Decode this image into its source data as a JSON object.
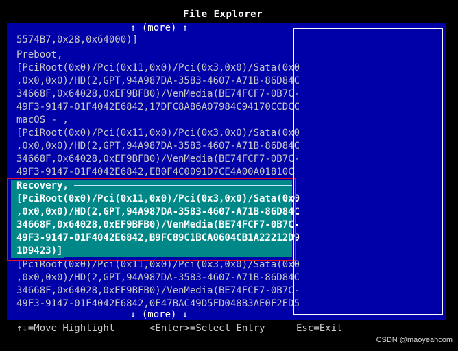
{
  "window": {
    "title": "File Explorer"
  },
  "scroll": {
    "more_up": "↑ (more) ↑",
    "more_down": "↓ (more) ↓"
  },
  "lines": [
    "5574B7,0x28,0x64000)]",
    "Preboot,",
    "[PciRoot(0x0)/Pci(0x11,0x0)/Pci(0x3,0x0)/Sata(0x0",
    ",0x0,0x0)/HD(2,GPT,94A987DA-3583-4607-A71B-86D84C",
    "34668F,0x64028,0xEF9BFB0)/VenMedia(BE74FCF7-0B7C-",
    "49F3-9147-01F4042E6842,17DFC8A86A07984C94170CCDCC",
    "macOS - ,",
    "[PciRoot(0x0)/Pci(0x11,0x0)/Pci(0x3,0x0)/Sata(0x0",
    ",0x0,0x0)/HD(2,GPT,94A987DA-3583-4607-A71B-86D84C",
    "34668F,0x64028,0xEF9BFB0)/VenMedia(BE74FCF7-0B7C-",
    "49F3-9147-01F4042E6842,EB0F4C0091D7CE4A00A01810C",
    "Recovery,",
    "[PciRoot(0x0)/Pci(0x11,0x0)/Pci(0x3,0x0)/Sata(0x0",
    ",0x0,0x0)/HD(2,GPT,94A987DA-3583-4607-A71B-86D84C",
    "34668F,0x64028,0xEF9BFB0)/VenMedia(BE74FCF7-0B7C-",
    "49F3-9147-01F4042E6842,B9FC89C1BCA0604CB1A22212D9",
    "1D9423)]",
    "[PciRoot(0x0)/Pci(0x11,0x0)/Pci(0x3,0x0)/Sata(0x0",
    ",0x0,0x0)/HD(2,GPT,94A987DA-3583-4607-A71B-86D84C",
    "34668F,0x64028,0xEF9BFB0)/VenMedia(BE74FCF7-0B7C-",
    "49F3-9147-01F4042E6842,0F47BAC49D5FD048B3AE0F2ED5"
  ],
  "status": {
    "move": "↑↓=Move Highlight",
    "enter": "<Enter>=Select Entry",
    "esc": "Esc=Exit"
  },
  "watermark": "CSDN @maoyeahcom",
  "colors": {
    "background": "#0000a8",
    "highlight": "#008888",
    "outline": "#e01020"
  }
}
